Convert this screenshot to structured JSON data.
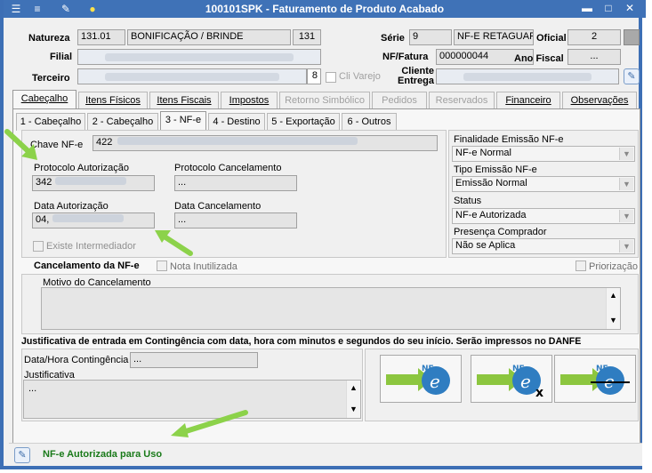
{
  "window": {
    "title": "100101SPK - Faturamento de Produto Acabado"
  },
  "header": {
    "natureza_label": "Natureza",
    "natureza_code": "131.01",
    "natureza_desc": "BONIFICAÇÃO / BRINDE",
    "natureza_num": "131",
    "filial_label": "Filial",
    "terceiro_label": "Terceiro",
    "terceiro_num": "8",
    "cli_varejo": "Cli Varejo",
    "serie_label": "Série",
    "serie_value": "9",
    "serie_desc": "NF-E RETAGUARD",
    "oficial_label": "Oficial",
    "oficial_value": "2",
    "nf_label": "NF/Fatura",
    "nf_value": "000000044",
    "ano_label": "Ano Fiscal",
    "ano_value": "...",
    "cliente_label": "Cliente Entrega"
  },
  "tabs": [
    "Cabeçalho",
    "Itens Físicos",
    "Itens Fiscais",
    "Impostos",
    "Retorno Simbólico",
    "Pedidos",
    "Reservados",
    "Financeiro",
    "Observações"
  ],
  "subtabs": [
    "1 - Cabeçalho",
    "2 - Cabeçalho",
    "3 - NF-e",
    "4 - Destino",
    "5 - Exportação",
    "6 - Outros"
  ],
  "nfe": {
    "chave_label": "Chave NF-e",
    "chave_value": "422",
    "prot_aut_label": "Protocolo Autorização",
    "prot_aut_value": "342",
    "prot_canc_label": "Protocolo Cancelamento",
    "prot_canc_value": "...",
    "data_aut_label": "Data Autorização",
    "data_aut_value": "04,",
    "data_canc_label": "Data Cancelamento",
    "data_canc_value": "...",
    "intermediador": "Existe Intermediador",
    "finalidade_label": "Finalidade Emissão NF-e",
    "finalidade_value": "NF-e Normal",
    "tipo_label": "Tipo Emissão NF-e",
    "tipo_value": "Emissão Normal",
    "status_label": "Status",
    "status_value": "NF-e Autorizada",
    "presenca_label": "Presença Comprador",
    "presenca_value": "Não se Aplica"
  },
  "cancel": {
    "title": "Cancelamento da NF-e",
    "nota_inutilizada": "Nota Inutilizada",
    "priorizacao": "Priorização",
    "motivo_label": "Motivo do Cancelamento"
  },
  "contingencia": {
    "title": "Justificativa de entrada em Contingência com data, hora com minutos e segundos do seu início. Serão impressos no DANFE",
    "data_label": "Data/Hora Contingência",
    "data_value": "...",
    "just_label": "Justificativa",
    "just_value": "..."
  },
  "status_bar": {
    "text": "NF-e Autorizada para Uso"
  },
  "colors": {
    "titlebar": "#3f72b7",
    "status_text": "#1a7a1a",
    "arrow": "#8cd24a"
  }
}
